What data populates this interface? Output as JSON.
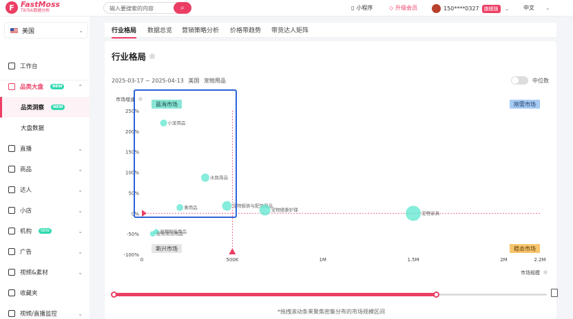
{
  "header": {
    "logo_name": "FastMoss",
    "logo_sub": "TikTok数据分析",
    "search_placeholder": "输入要搜索的内容",
    "mini_program": "小程序",
    "upgrade": "升级会员",
    "user_phone": "150****0327",
    "badge": "旗舰版",
    "language": "中文"
  },
  "sidebar": {
    "country": "美国",
    "items": [
      {
        "label": "工作台"
      },
      {
        "label": "品类大盘",
        "tag": "NEW"
      },
      {
        "label": "品类洞察",
        "tag": "NEW"
      },
      {
        "label": "大盘数据"
      },
      {
        "label": "直播"
      },
      {
        "label": "商品"
      },
      {
        "label": "达人"
      },
      {
        "label": "小店"
      },
      {
        "label": "机构",
        "tag": "NEW"
      },
      {
        "label": "广告"
      },
      {
        "label": "视频&素材"
      },
      {
        "label": "收藏夹"
      },
      {
        "label": "视频/直播监控"
      }
    ]
  },
  "tabs": [
    "行业格局",
    "数据总览",
    "营销策略分析",
    "价格带趋势",
    "带货达人矩阵"
  ],
  "card": {
    "title": "行业格局",
    "date_range": "2025-03-17 ~ 2025-04-13",
    "region": "美国",
    "category": "宠物用品",
    "median_label": "中位数"
  },
  "quadrants": {
    "top_left": "蓝海市场",
    "top_right": "刚需市场",
    "bottom_left": "新兴市场",
    "bottom_right": "稳态市场"
  },
  "colors": {
    "accent": "#ec3e64",
    "bubble": "#5ee6cf",
    "blue_box": "#2a62d8"
  },
  "chart_data": {
    "type": "scatter",
    "ylabel": "市场增速",
    "xlabel": "市场规模",
    "x_ticks": [
      "0",
      "500K",
      "1M",
      "1.5M",
      "2M",
      "2.2M"
    ],
    "y_ticks": [
      "250%",
      "200%",
      "150%",
      "100%",
      "50%",
      "0%",
      "-50%",
      "-100%"
    ],
    "xlim": [
      0,
      2200000
    ],
    "ylim": [
      -100,
      250
    ],
    "median_x": 500000,
    "median_y": 0,
    "points": [
      {
        "name": "小宠用品",
        "x": 120000,
        "y": 220,
        "size": 5
      },
      {
        "name": "水族用品",
        "x": 350000,
        "y": 87,
        "size": 6
      },
      {
        "name": "禽用品",
        "x": 210000,
        "y": 14,
        "size": 5
      },
      {
        "name": "宠物服装与配饰用品",
        "x": 470000,
        "y": 18,
        "size": 7
      },
      {
        "name": "宠物健康护理",
        "x": 680000,
        "y": 8,
        "size": 8
      },
      {
        "name": "宠物家具",
        "x": 1500000,
        "y": 0,
        "size": 11
      },
      {
        "name": "宠物智能用品",
        "x": 80000,
        "y": -45,
        "size": 4
      },
      {
        "name": "宠物清洁用品",
        "x": 60000,
        "y": -50,
        "size": 4
      }
    ]
  },
  "footer": {
    "hint": "*拖拽滚动条来聚焦密集分布的市场规模区间"
  }
}
